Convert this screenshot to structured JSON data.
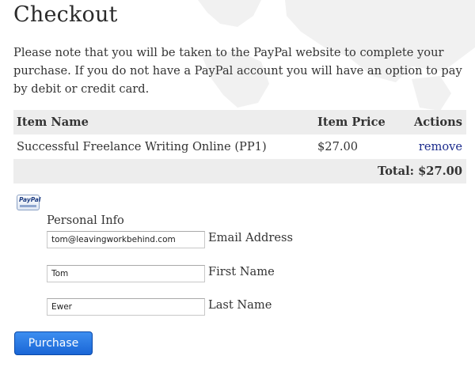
{
  "page": {
    "title": "Checkout",
    "intro": "Please note that you will be taken to the PayPal website to complete your purchase. If you do not have a PayPal account you will have an option to pay by debit or credit card."
  },
  "cart": {
    "headers": {
      "item_name": "Item Name",
      "item_price": "Item Price",
      "actions": "Actions"
    },
    "items": [
      {
        "name": "Successful Freelance Writing Online (PP1)",
        "price": "$27.00",
        "action": "remove"
      }
    ],
    "total": "Total: $27.00"
  },
  "payment": {
    "icon": "paypal-icon",
    "icon_text": "PayPal"
  },
  "personal_info": {
    "heading": "Personal Info",
    "email": {
      "value": "tom@leavingworkbehind.com",
      "label": "Email Address"
    },
    "first_name": {
      "value": "Tom",
      "label": "First Name"
    },
    "last_name": {
      "value": "Ewer",
      "label": "Last Name"
    }
  },
  "actions": {
    "purchase_label": "Purchase"
  },
  "colors": {
    "header_bg": "#ededed",
    "link": "#1a2a8c",
    "button": "#1a66d6"
  }
}
